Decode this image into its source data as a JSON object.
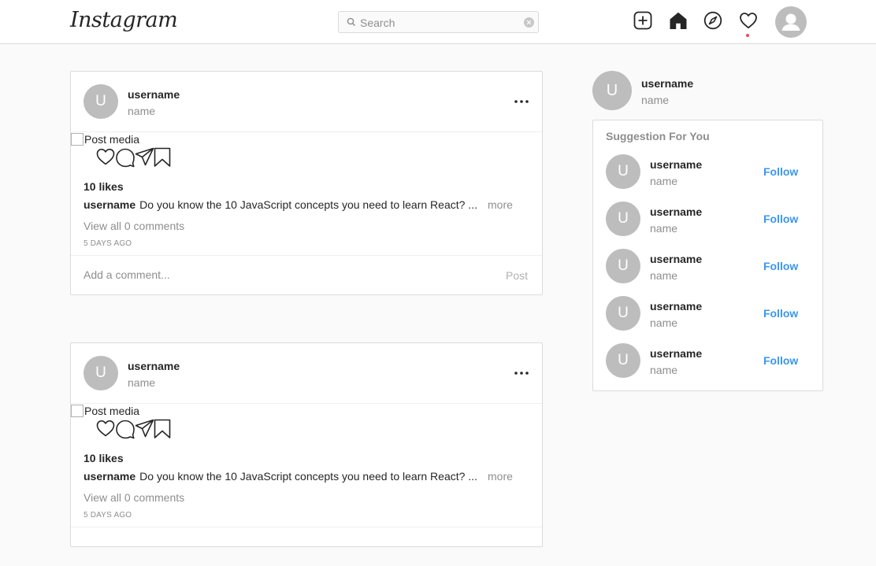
{
  "header": {
    "logo": "Instagram",
    "search_placeholder": "Search",
    "icons": [
      "add-post-icon",
      "home-icon",
      "explore-compass-icon",
      "activity-heart-icon",
      "profile-avatar-icon"
    ],
    "notification_dot_color": "#ed4956"
  },
  "posts": [
    {
      "avatar_letter": "U",
      "username": "username",
      "name": "name",
      "media_alt": "Post media",
      "likes": "10 likes",
      "caption_user": "username",
      "caption_text": "Do you know the 10 JavaScript concepts you need to learn React? ...",
      "more": "more",
      "view_comments": "View all 0 comments",
      "time_ago": "5 DAYS AGO",
      "comment_placeholder": "Add a comment...",
      "post_button": "Post"
    },
    {
      "avatar_letter": "U",
      "username": "username",
      "name": "name",
      "media_alt": "Post media",
      "likes": "10 likes",
      "caption_user": "username",
      "caption_text": "Do you know the 10 JavaScript concepts you need to learn React? ...",
      "more": "more",
      "view_comments": "View all 0 comments",
      "time_ago": "5 DAYS AGO"
    }
  ],
  "sidebar": {
    "current_user": {
      "avatar_letter": "U",
      "username": "username",
      "name": "name"
    },
    "suggestions_title": "Suggestion For You",
    "suggestions": [
      {
        "avatar_letter": "U",
        "username": "username",
        "name": "name",
        "action": "Follow"
      },
      {
        "avatar_letter": "U",
        "username": "username",
        "name": "name",
        "action": "Follow"
      },
      {
        "avatar_letter": "U",
        "username": "username",
        "name": "name",
        "action": "Follow"
      },
      {
        "avatar_letter": "U",
        "username": "username",
        "name": "name",
        "action": "Follow"
      },
      {
        "avatar_letter": "U",
        "username": "username",
        "name": "name",
        "action": "Follow"
      }
    ],
    "follow_color": "#3897f0"
  }
}
